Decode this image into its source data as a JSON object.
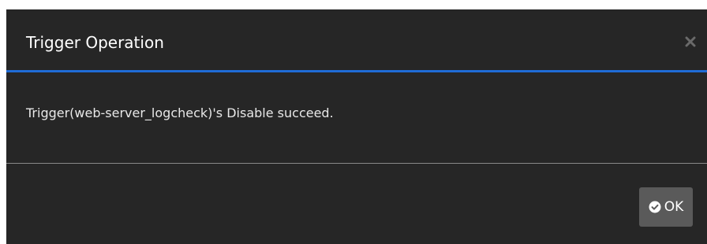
{
  "dialog": {
    "title": "Trigger Operation",
    "close_icon": "close-icon",
    "message": "Trigger(web-server_logcheck)'s Disable succeed.",
    "ok_label": "OK",
    "ok_icon": "check-circle-icon"
  },
  "colors": {
    "background": "#262626",
    "header_accent": "#1f6bd6",
    "button_bg": "#5a5a5a",
    "text": "#ffffff"
  }
}
